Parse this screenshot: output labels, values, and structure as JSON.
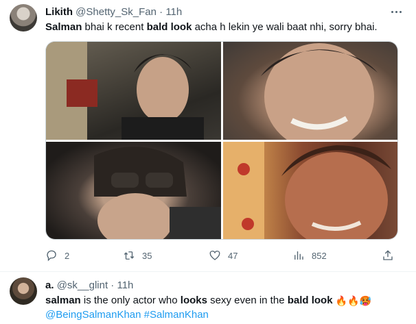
{
  "tweet": {
    "author_name": "Likith",
    "handle": "@Shetty_Sk_Fan",
    "separator": "·",
    "time": "11h",
    "text_parts": [
      "Salman",
      " bhai k recent ",
      "bald look",
      " acha h lekin ye wali baat nhi, sorry bhai."
    ],
    "stats": {
      "replies": "2",
      "retweets": "35",
      "likes": "47",
      "views": "852"
    },
    "icons": [
      "more-icon",
      "reply-icon",
      "retweet-icon",
      "like-icon",
      "views-icon",
      "share-icon"
    ]
  },
  "reply": {
    "author_name": "a.",
    "handle": "@sk__glint",
    "separator": "·",
    "time": "11h",
    "text_parts": [
      "salman",
      " is the only actor who ",
      "looks",
      " sexy even in the ",
      "bald look",
      " "
    ],
    "emojis": [
      "🔥",
      "🔥",
      "🥵"
    ],
    "mentions": [
      "@BeingSalmanKhan",
      "#SalmanKhan"
    ]
  },
  "colors": {
    "text": "#0f1419",
    "secondary": "#536471",
    "link": "#1d9bf0",
    "border": "#cfd9de"
  }
}
